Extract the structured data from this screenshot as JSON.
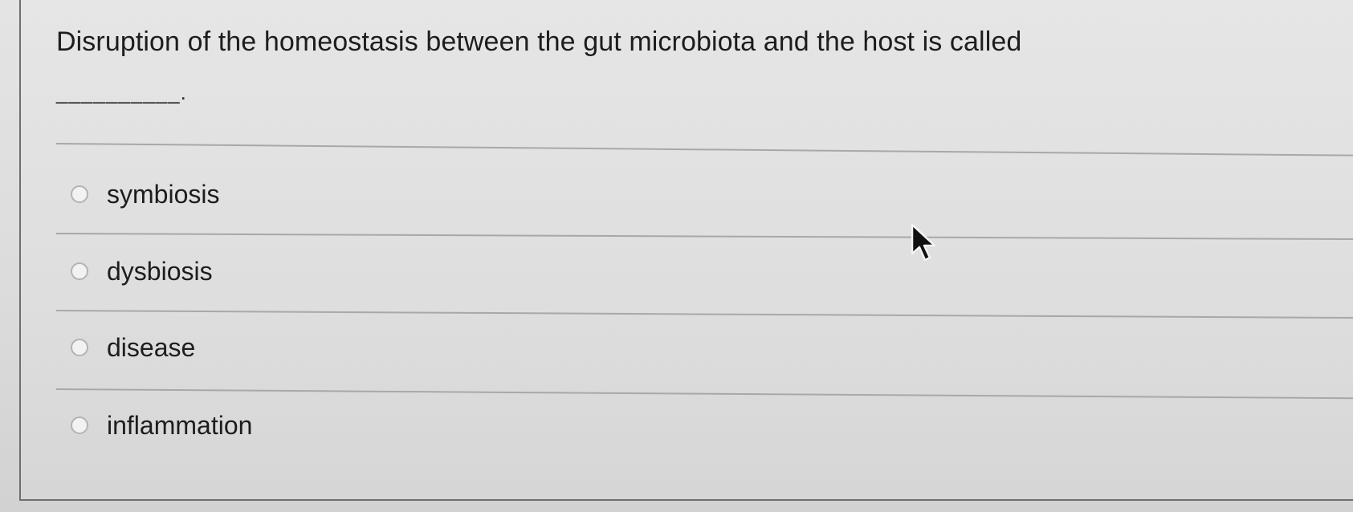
{
  "question": {
    "text": "Disruption of the homeostasis between the gut microbiota and the host is called",
    "blank": "__________."
  },
  "options": [
    {
      "label": "symbiosis",
      "selected": false
    },
    {
      "label": "dysbiosis",
      "selected": false
    },
    {
      "label": "disease",
      "selected": false
    },
    {
      "label": "inflammation",
      "selected": false
    }
  ],
  "colors": {
    "background": "#dcdcdc",
    "text": "#1d1d1d",
    "divider": "#a8a8a8",
    "radio_border": "#b3b3b3"
  },
  "icons": {
    "cursor": "mouse-pointer-icon",
    "radio": "radio-unselected-icon"
  }
}
